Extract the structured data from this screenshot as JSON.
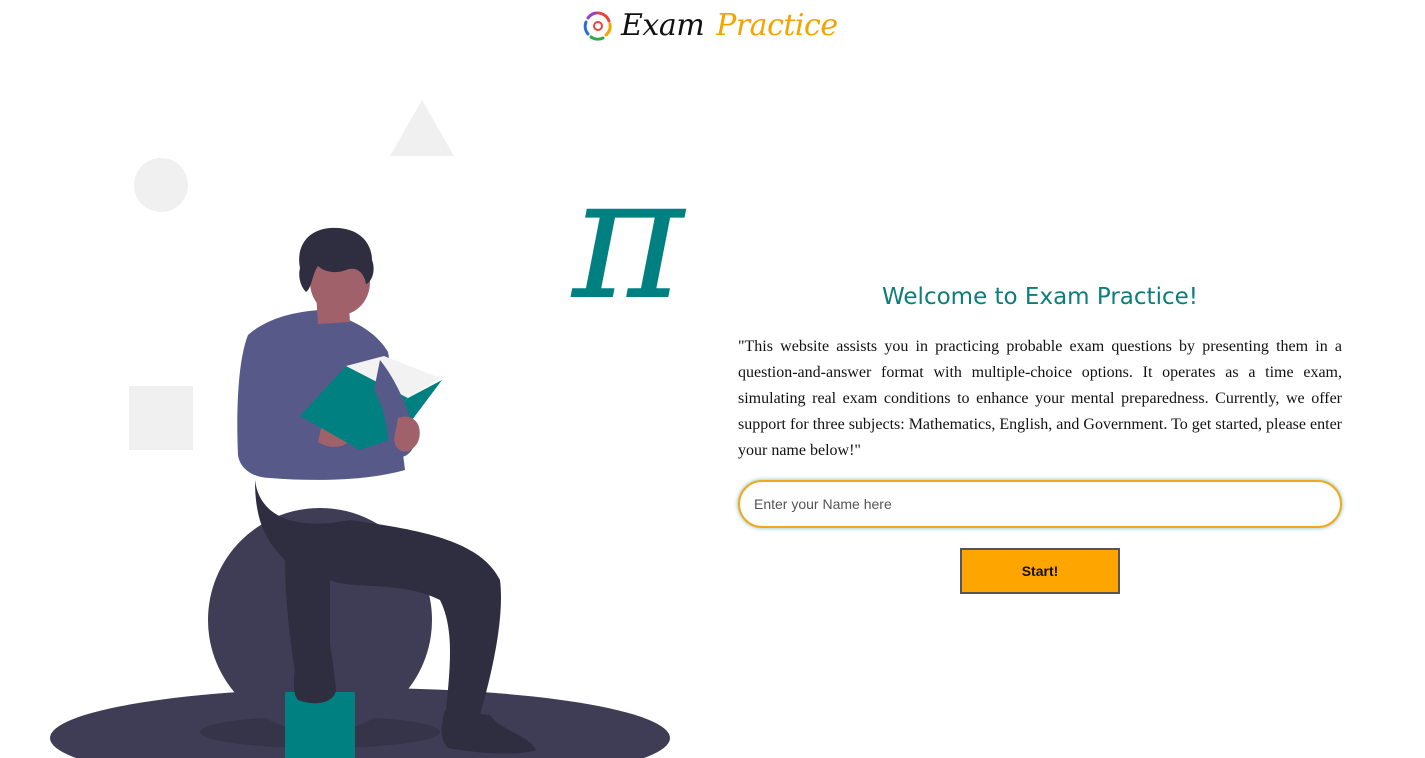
{
  "header": {
    "logo_icon": "colorful-pinwheel-icon",
    "brand_first": "Exam",
    "brand_second": "Practice"
  },
  "illustration": {
    "icon": "person-reading-book-illustration",
    "symbol": "π"
  },
  "main": {
    "title": "Welcome to Exam Practice!",
    "description": "\"This website assists you in practicing probable exam questions by presenting them in a question-and-answer format with multiple-choice options. It operates as a time exam, simulating real exam conditions to enhance your mental preparedness. Currently, we offer support for three subjects: Mathematics, English, and Government. To get started, please enter your name below!\"",
    "name_input": {
      "placeholder": "Enter your Name here",
      "value": ""
    },
    "start_label": "Start!"
  },
  "colors": {
    "accent_teal": "#0c7d7a",
    "accent_orange": "#ffa500",
    "input_border": "#f2a81d"
  }
}
